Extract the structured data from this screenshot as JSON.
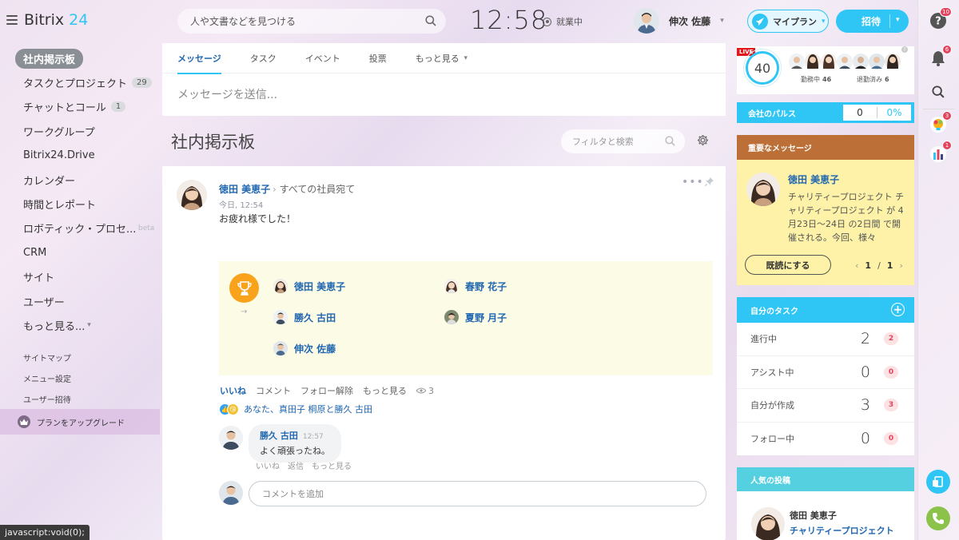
{
  "app": {
    "logo_main": "Bitrix",
    "logo_num": "24"
  },
  "sidebar": {
    "items": [
      {
        "label": "社内掲示板",
        "count": ""
      },
      {
        "label": "タスクとプロジェクト",
        "count": "29"
      },
      {
        "label": "チャットとコール",
        "count": "1"
      },
      {
        "label": "ワークグループ",
        "count": ""
      },
      {
        "label": "Bitrix24.Drive",
        "count": ""
      },
      {
        "label": "カレンダー",
        "count": ""
      },
      {
        "label": "時間とレポート",
        "count": ""
      },
      {
        "label": "ロボティック・プロセ...",
        "count": "",
        "tag": "beta"
      },
      {
        "label": "CRM",
        "count": ""
      },
      {
        "label": "サイト",
        "count": ""
      },
      {
        "label": "ユーザー",
        "count": ""
      },
      {
        "label": "もっと見る...",
        "count": ""
      }
    ],
    "sub_items": [
      "サイトマップ",
      "メニュー設定",
      "ユーザー招待"
    ],
    "upgrade_label": "プランをアップグレード"
  },
  "header": {
    "search_placeholder": "人や文書などを見つける",
    "clock": "12:58",
    "work_status": "就業中",
    "user_name": "伸次 佐藤",
    "myplan_label": "マイプラン",
    "invite_label": "招待"
  },
  "composer": {
    "tabs": [
      "メッセージ",
      "タスク",
      "イベント",
      "投票",
      "もっと見る"
    ],
    "input_placeholder": "メッセージを送信..."
  },
  "page": {
    "title": "社内掲示板",
    "filter_placeholder": "フィルタと検索"
  },
  "post": {
    "author": "徳田 美恵子",
    "destination": "すべての社員宛て",
    "time": "今日, 12:54",
    "text": "お疲れ様でした！",
    "grat_users": [
      "徳田 美恵子",
      "春野 花子",
      "勝久 古田",
      "夏野 月子",
      "伸次 佐藤"
    ],
    "actions": [
      "いいね",
      "コメント",
      "フォロー解除",
      "もっと見る"
    ],
    "views": "3",
    "reactions_text": "あなた、真田子 桐原と勝久 古田",
    "comment": {
      "author": "勝久 古田",
      "time": "12:57",
      "text": "よく頑張ったね。",
      "actions": [
        "いいね",
        "返信",
        "もっと見る"
      ]
    },
    "comment_placeholder": "コメントを追加"
  },
  "right": {
    "live": {
      "badge": "LIVE",
      "count": "40",
      "working_label": "勤務中",
      "working_count": "46",
      "left_label": "退勤済み",
      "left_count": "6"
    },
    "pulse": {
      "label": "会社のパルス",
      "value": "0",
      "percent": "0%"
    },
    "important": {
      "title": "重要なメッセージ",
      "author": "徳田 美恵子",
      "text": "チャリティープロジェクト チャリティープロジェクト が 4月23日〜24日 の2日間 で開催される。今回、様々",
      "button": "既読にする",
      "page_current": "1",
      "page_sep": "/",
      "page_total": "1"
    },
    "tasks": {
      "title": "自分のタスク",
      "rows": [
        {
          "label": "進行中",
          "value": "2",
          "badge": "2"
        },
        {
          "label": "アシスト中",
          "value": "0",
          "badge": "0"
        },
        {
          "label": "自分が作成",
          "value": "3",
          "badge": "3"
        },
        {
          "label": "フォロー中",
          "value": "0",
          "badge": "0"
        }
      ]
    },
    "popular": {
      "title": "人気の投稿",
      "author": "徳田 美恵子",
      "post_title": "チャリティープロジェクト"
    }
  },
  "rightbar": {
    "help_badge": "10",
    "notif_badge": "6",
    "app1_badge": "3",
    "app2_badge": "1"
  },
  "status_bar": "javascript:void(0);"
}
